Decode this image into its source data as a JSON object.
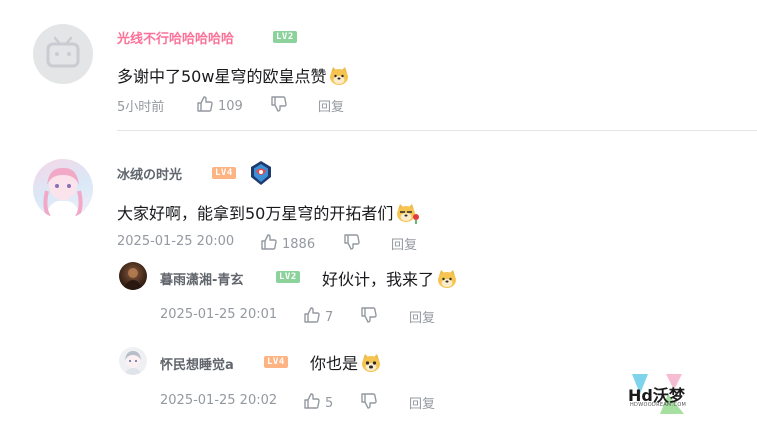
{
  "comments": [
    {
      "username": "光线不行哈哈哈哈哈",
      "username_color": "#fb7299",
      "level": "LV2",
      "level_color": "#8bd29b",
      "content": "多谢中了50w星穹的欧皇点赞",
      "time": "5小时前",
      "likes": "109",
      "reply_label": "回复"
    },
    {
      "username": "冰绒の时光",
      "username_color": "#61666d",
      "level": "LV4",
      "level_color": "#feb383",
      "content": "大家好啊，能拿到50万星穹的开拓者们",
      "time": "2025-01-25 20:00",
      "likes": "1886",
      "reply_label": "回复",
      "replies": [
        {
          "username": "暮雨潇湘-青玄",
          "level": "LV2",
          "level_color": "#8bd29b",
          "content": "好伙计，我来了",
          "time": "2025-01-25 20:01",
          "likes": "7",
          "reply_label": "回复"
        },
        {
          "username": "怀民想睡觉a",
          "level": "LV4",
          "level_color": "#feb383",
          "content": "你也是",
          "time": "2025-01-25 20:02",
          "likes": "5",
          "reply_label": "回复"
        }
      ]
    }
  ],
  "watermark": {
    "text": "Hd沃梦",
    "subtext": "HDWOODREAM.COM"
  }
}
